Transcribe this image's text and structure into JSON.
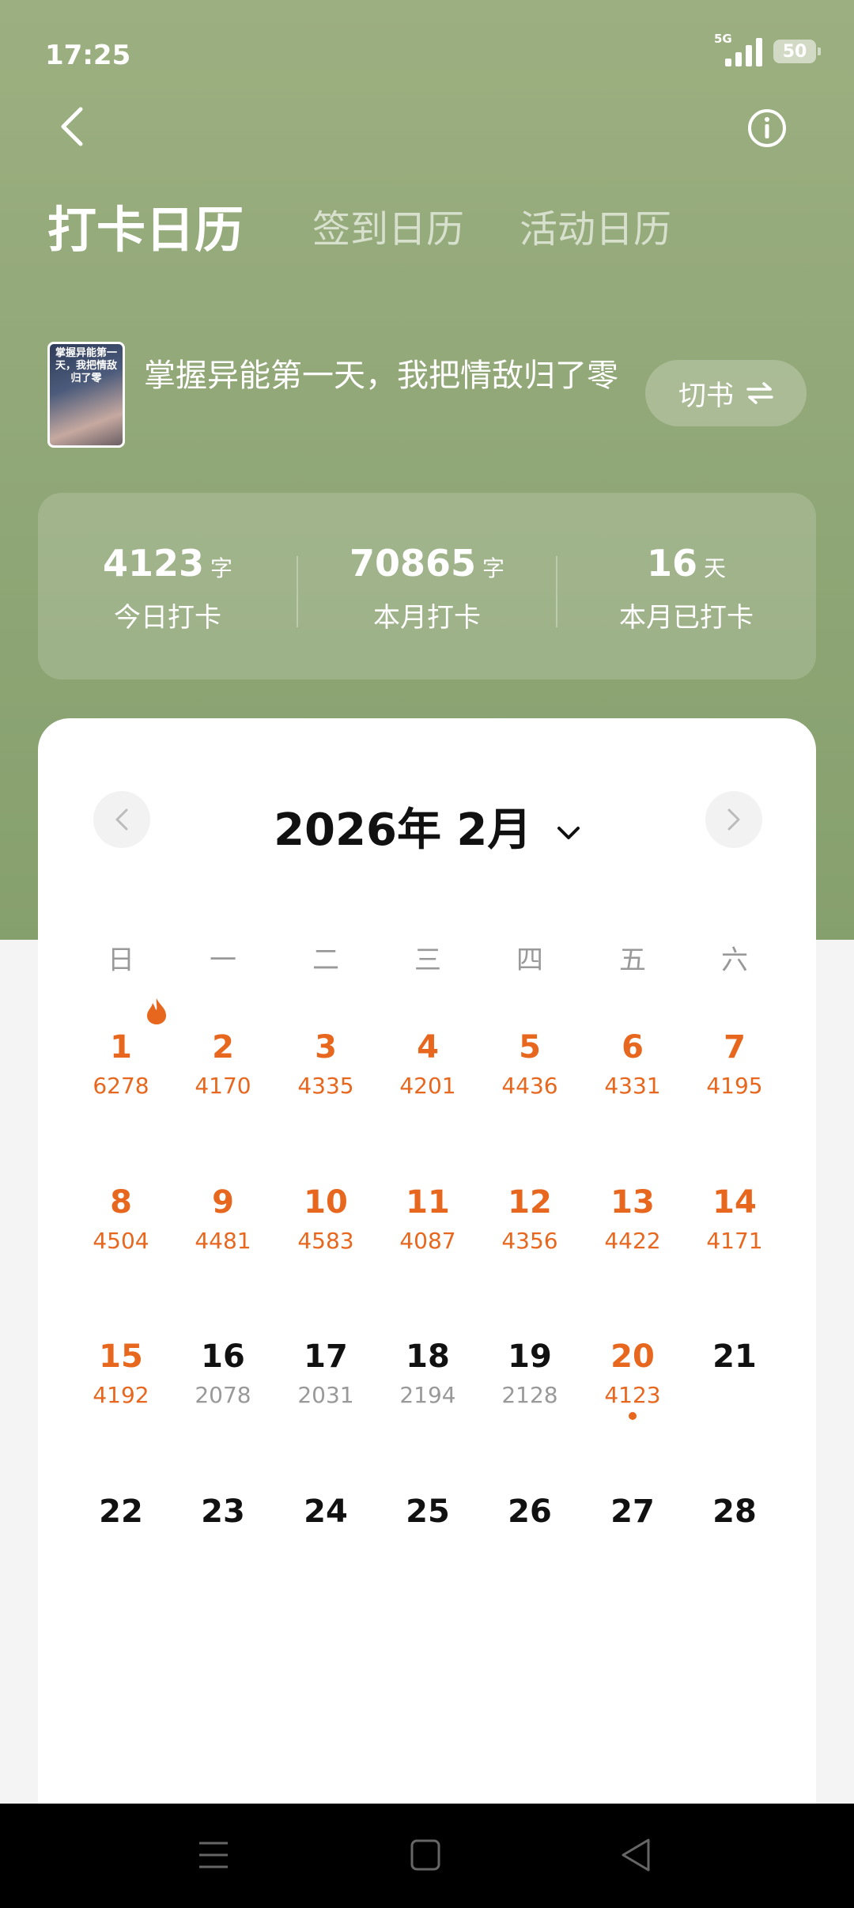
{
  "status": {
    "time": "17:25",
    "network": "5G",
    "battery": "50"
  },
  "tabs": [
    {
      "label": "打卡日历",
      "active": true
    },
    {
      "label": "签到日历",
      "active": false
    },
    {
      "label": "活动日历",
      "active": false
    }
  ],
  "book": {
    "cover_text": "掌握异能第一天，我把情敌归了零",
    "title": "掌握异能第一天，我把情敌归了零",
    "switch_label": "切书",
    "switch_icon": "swap-arrows-icon"
  },
  "stats": [
    {
      "value": "4123",
      "unit": "字",
      "label": "今日打卡"
    },
    {
      "value": "70865",
      "unit": "字",
      "label": "本月打卡"
    },
    {
      "value": "16",
      "unit": "天",
      "label": "本月已打卡"
    }
  ],
  "calendar": {
    "month_title": "2026年 2月",
    "weekdays": [
      "日",
      "一",
      "二",
      "三",
      "四",
      "五",
      "六"
    ],
    "highlight_color": "#e8671e",
    "days": [
      {
        "day": "1",
        "count": "6278",
        "checked": true,
        "flame": true
      },
      {
        "day": "2",
        "count": "4170",
        "checked": true
      },
      {
        "day": "3",
        "count": "4335",
        "checked": true
      },
      {
        "day": "4",
        "count": "4201",
        "checked": true
      },
      {
        "day": "5",
        "count": "4436",
        "checked": true
      },
      {
        "day": "6",
        "count": "4331",
        "checked": true
      },
      {
        "day": "7",
        "count": "4195",
        "checked": true
      },
      {
        "day": "8",
        "count": "4504",
        "checked": true
      },
      {
        "day": "9",
        "count": "4481",
        "checked": true
      },
      {
        "day": "10",
        "count": "4583",
        "checked": true
      },
      {
        "day": "11",
        "count": "4087",
        "checked": true
      },
      {
        "day": "12",
        "count": "4356",
        "checked": true
      },
      {
        "day": "13",
        "count": "4422",
        "checked": true
      },
      {
        "day": "14",
        "count": "4171",
        "checked": true
      },
      {
        "day": "15",
        "count": "4192",
        "checked": true
      },
      {
        "day": "16",
        "count": "2078",
        "checked": false
      },
      {
        "day": "17",
        "count": "2031",
        "checked": false
      },
      {
        "day": "18",
        "count": "2194",
        "checked": false
      },
      {
        "day": "19",
        "count": "2128",
        "checked": false
      },
      {
        "day": "20",
        "count": "4123",
        "checked": true,
        "today": true
      },
      {
        "day": "21",
        "count": "",
        "checked": false
      },
      {
        "day": "22",
        "count": "",
        "checked": false
      },
      {
        "day": "23",
        "count": "",
        "checked": false
      },
      {
        "day": "24",
        "count": "",
        "checked": false
      },
      {
        "day": "25",
        "count": "",
        "checked": false
      },
      {
        "day": "26",
        "count": "",
        "checked": false
      },
      {
        "day": "27",
        "count": "",
        "checked": false
      },
      {
        "day": "28",
        "count": "",
        "checked": false
      }
    ]
  }
}
